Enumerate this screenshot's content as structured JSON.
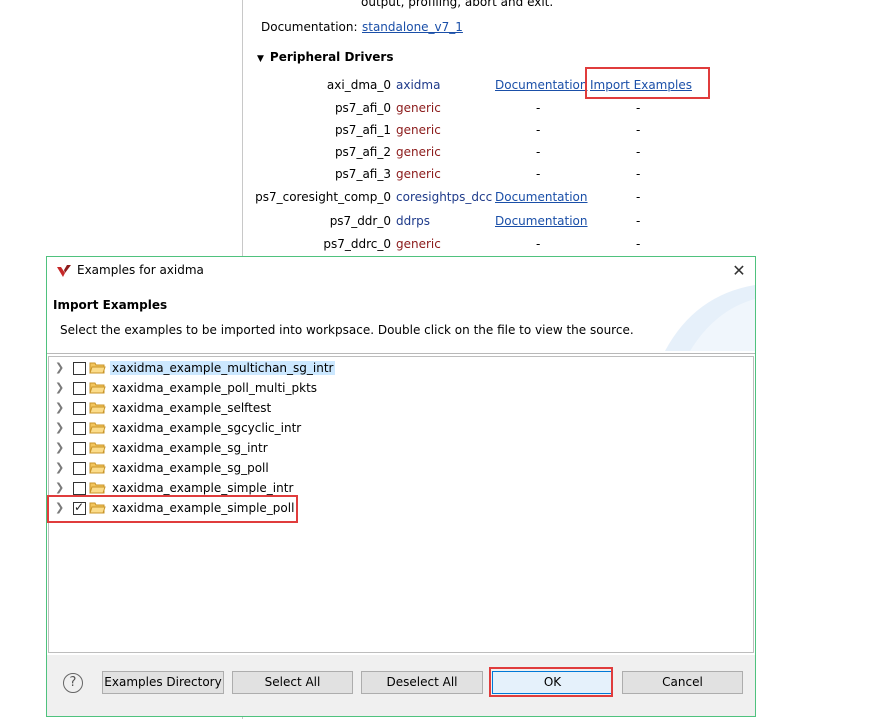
{
  "background": {
    "top_line": "output, profiling, abort and exit.",
    "documentation_label": "Documentation:",
    "documentation_link": "standalone_v7_1",
    "section_title": "Peripheral Drivers",
    "drivers": [
      {
        "name": "axi_dma_0",
        "driver": "axidma",
        "doc": "Documentation",
        "examples": "Import Examples"
      },
      {
        "name": "ps7_afi_0",
        "driver": "generic",
        "doc": "-",
        "examples": "-"
      },
      {
        "name": "ps7_afi_1",
        "driver": "generic",
        "doc": "-",
        "examples": "-"
      },
      {
        "name": "ps7_afi_2",
        "driver": "generic",
        "doc": "-",
        "examples": "-"
      },
      {
        "name": "ps7_afi_3",
        "driver": "generic",
        "doc": "-",
        "examples": "-"
      },
      {
        "name": "ps7_coresight_comp_0",
        "driver": "coresightps_dcc",
        "doc": "Documentation",
        "examples": "-"
      },
      {
        "name": "ps7_ddr_0",
        "driver": "ddrps",
        "doc": "Documentation",
        "examples": "-"
      },
      {
        "name": "ps7_ddrc_0",
        "driver": "generic",
        "doc": "-",
        "examples": "-"
      }
    ]
  },
  "dialog": {
    "title": "Examples for axidma",
    "header_title": "Import Examples",
    "header_desc": "Select the examples to be imported into workpsace. Double click on the file to view the source.",
    "examples": [
      {
        "label": "xaxidma_example_multichan_sg_intr",
        "checked": false,
        "selected": true
      },
      {
        "label": "xaxidma_example_poll_multi_pkts",
        "checked": false,
        "selected": false
      },
      {
        "label": "xaxidma_example_selftest",
        "checked": false,
        "selected": false
      },
      {
        "label": "xaxidma_example_sgcyclic_intr",
        "checked": false,
        "selected": false
      },
      {
        "label": "xaxidma_example_sg_intr",
        "checked": false,
        "selected": false
      },
      {
        "label": "xaxidma_example_sg_poll",
        "checked": false,
        "selected": false
      },
      {
        "label": "xaxidma_example_simple_intr",
        "checked": false,
        "selected": false
      },
      {
        "label": "xaxidma_example_simple_poll",
        "checked": true,
        "selected": false
      }
    ],
    "buttons": {
      "examples_directory": "Examples Directory",
      "select_all": "Select All",
      "deselect_all": "Deselect All",
      "ok": "OK",
      "cancel": "Cancel"
    },
    "help_symbol": "?"
  },
  "colors": {
    "link": "#1a4fa8",
    "generic_driver": "#8b1a1a",
    "highlight_box": "#e03c3c",
    "dialog_border": "#4fc27e",
    "selection": "#cce8ff"
  },
  "icons": [
    "twisty-down-icon",
    "app-logo-icon",
    "close-icon",
    "chevron-right-icon",
    "folder-icon",
    "help-icon"
  ]
}
